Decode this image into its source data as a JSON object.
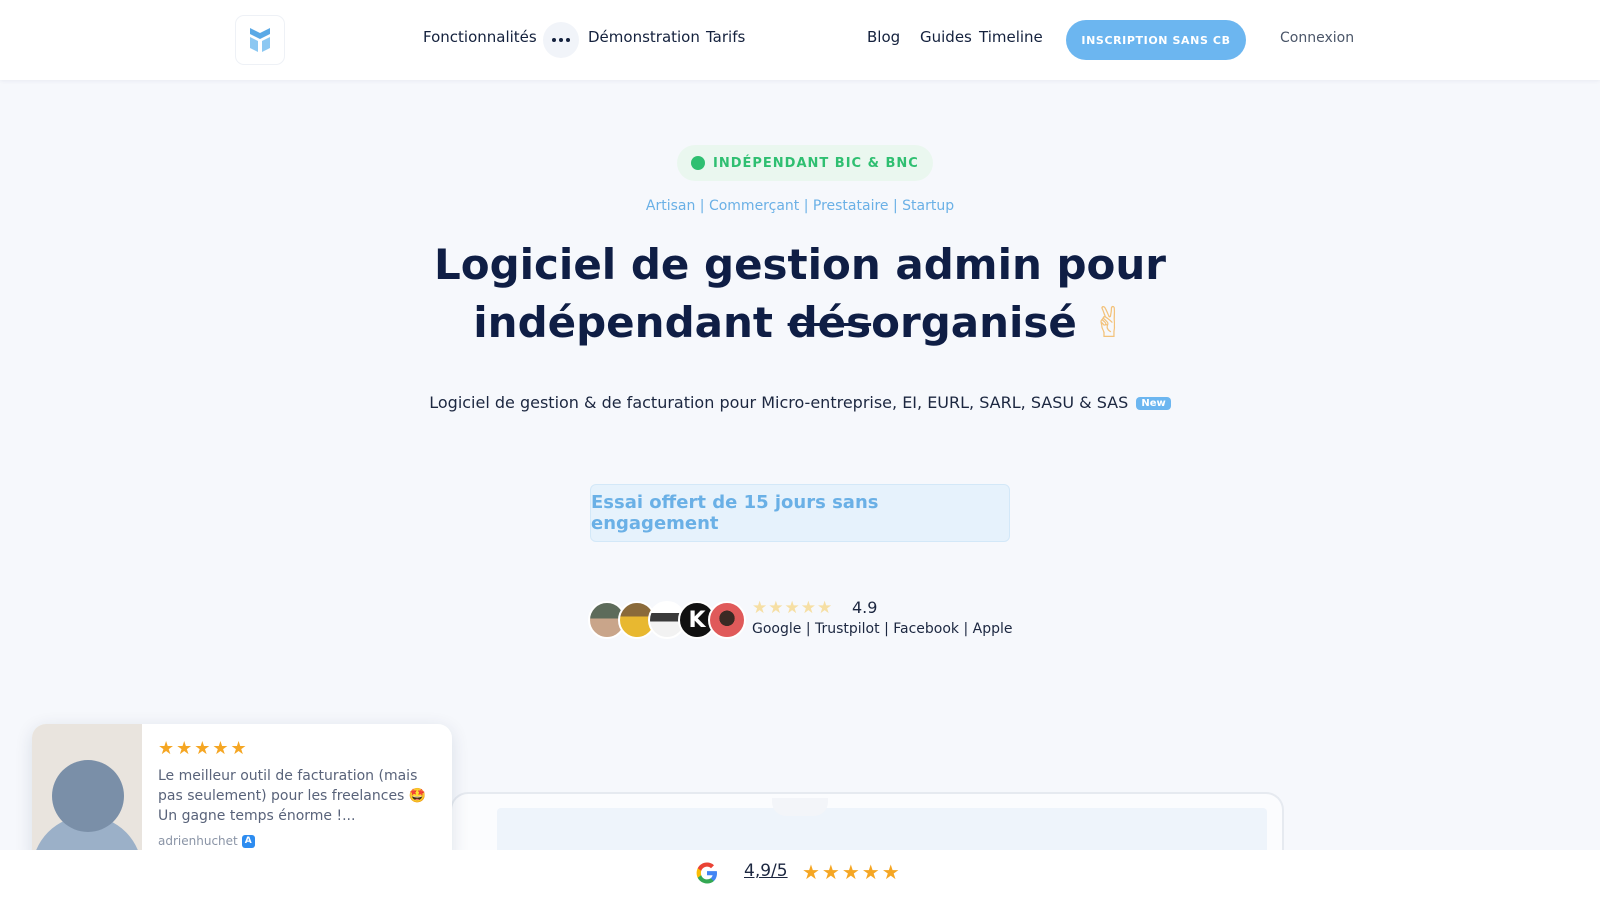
{
  "header": {
    "nav_left": [
      "Fonctionnalités",
      "Démonstration",
      "Tarifs"
    ],
    "nav_right": [
      "Blog",
      "Guides",
      "Timeline"
    ],
    "cta_label": "INSCRIPTION SANS CB",
    "login_label": "Connexion"
  },
  "hero": {
    "badge": "INDÉPENDANT BIC & BNC",
    "categories": "Artisan | Commerçant | Prestataire | Startup",
    "title_line1": "Logiciel de gestion admin pour",
    "title_line2_prefix": "indépendant ",
    "title_line2_strike": "dés",
    "title_line2_suffix": "organisé",
    "title_emoji": "✌",
    "subtitle": "Logiciel de gestion & de facturation pour Micro-entreprise, EI, EURL, SARL, SASU & SAS",
    "new_label": "New",
    "trial_label": "Essai offert de 15 jours sans engagement"
  },
  "social_proof": {
    "avatar_letter": "K",
    "stars": "★★★★★",
    "rating": "4.9",
    "sources": "Google | Trustpilot | Facebook | Apple"
  },
  "review": {
    "stars": "★★★★★",
    "text": "Le meilleur outil de facturation (mais pas seulement) pour les freelances 🤩 Un gagne temps énorme !...",
    "author": "adrienhuchet",
    "store_glyph": "A"
  },
  "bottom_bar": {
    "score": "4,9/5",
    "stars": "★★★★★"
  },
  "colors": {
    "accent": "#6cb6f0",
    "title": "#0f1e45",
    "badge_green": "#2fbf71",
    "star": "#f5a623"
  }
}
